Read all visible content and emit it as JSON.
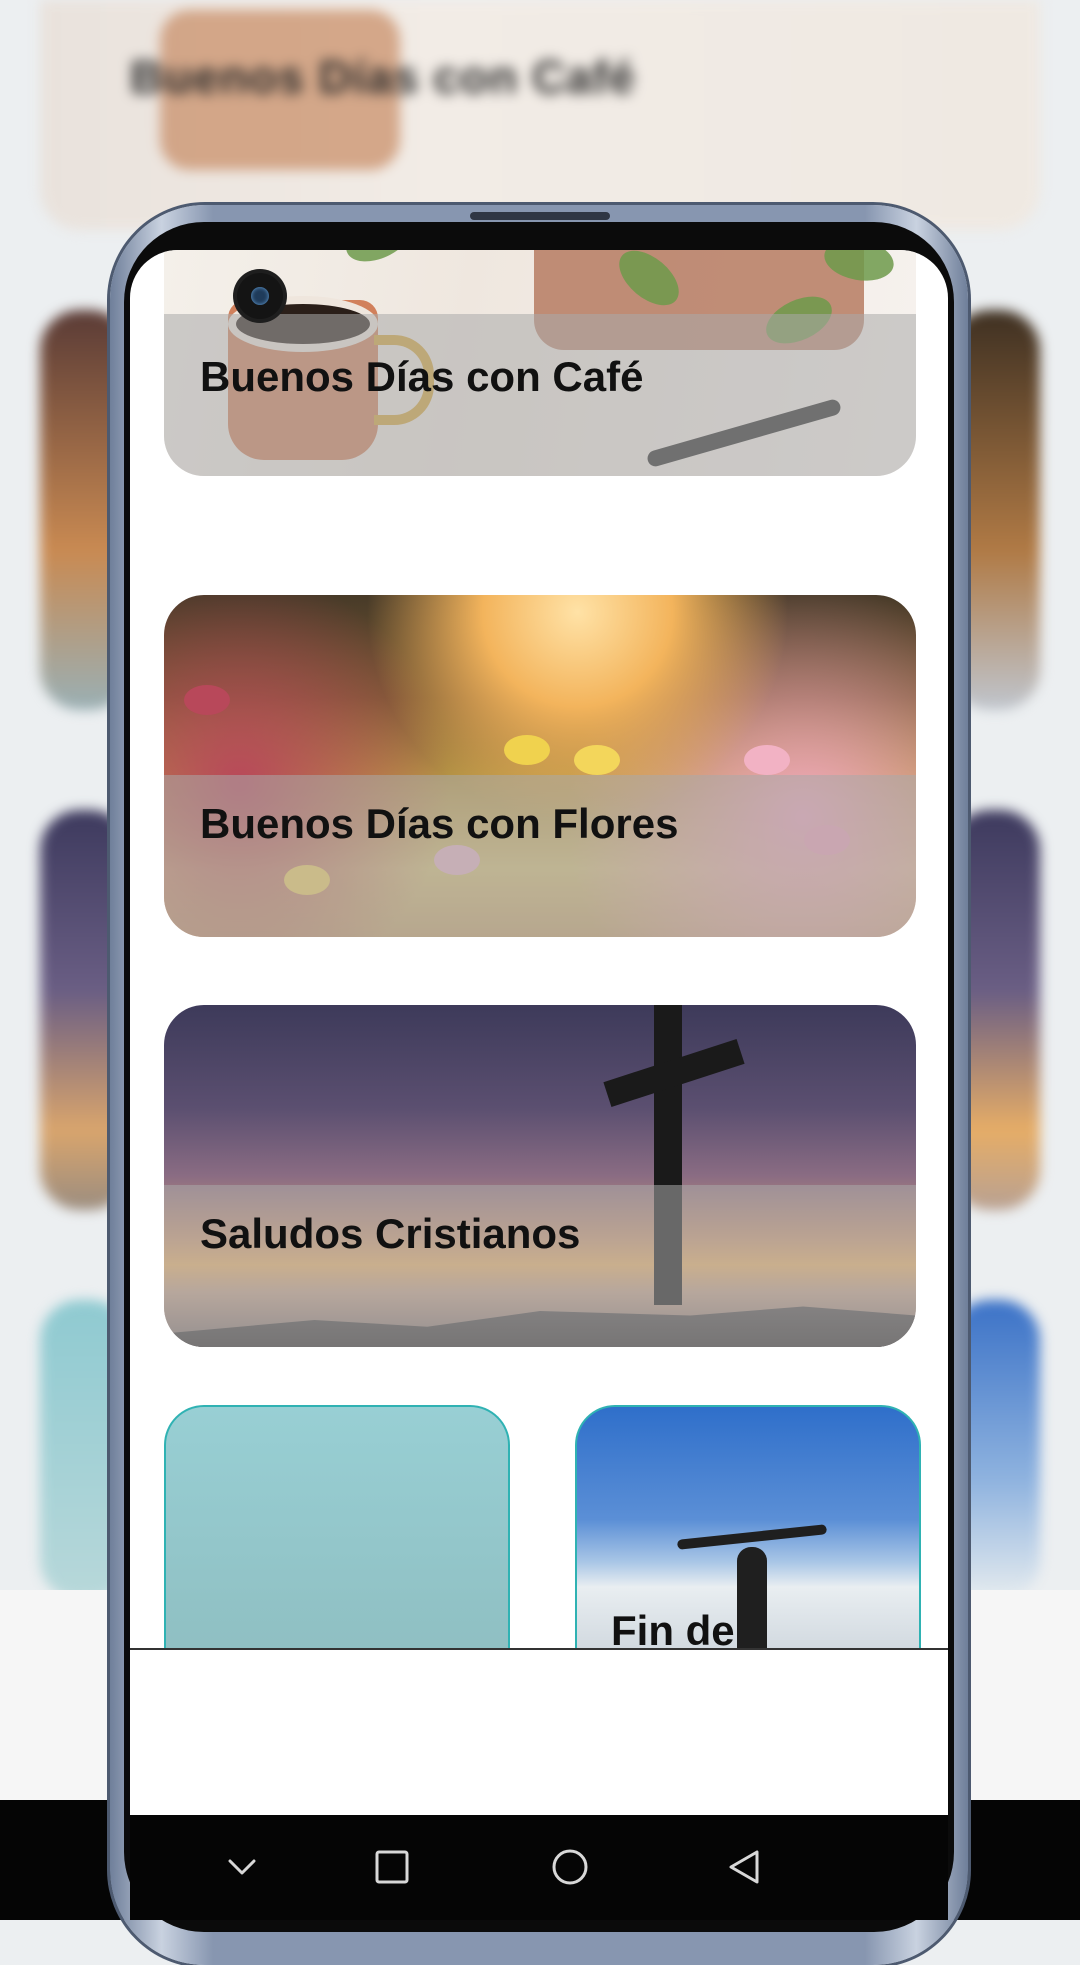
{
  "background": {
    "top_card_title": "Buenos Días con Café"
  },
  "cards": [
    {
      "title": "Buenos Días con Café"
    },
    {
      "title": "Buenos Días con Flores"
    },
    {
      "title": "Saludos Cristianos"
    },
    {
      "title": ""
    },
    {
      "title": "Fin de"
    }
  ],
  "navbar": {
    "icons": [
      "chevron-down-icon",
      "square-recents-icon",
      "circle-home-icon",
      "triangle-back-icon"
    ]
  },
  "colors": {
    "card_border_accent": "#2fb2b3",
    "label_band": "#aaaaaa",
    "navbar_bg": "#050505"
  }
}
